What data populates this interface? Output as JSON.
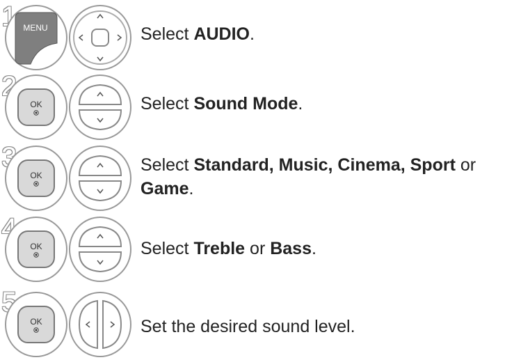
{
  "steps": [
    {
      "number": "1",
      "icons": [
        "menu-button-icon",
        "navigation-pad-icon"
      ],
      "text": {
        "pre": "Select ",
        "bold": "AUDIO",
        "post": "."
      },
      "menu_label": "MENU"
    },
    {
      "number": "2",
      "icons": [
        "ok-button-icon",
        "up-down-buttons-icon"
      ],
      "text": {
        "pre": "Select ",
        "bold": "Sound Mode",
        "post": "."
      },
      "ok_label": "OK"
    },
    {
      "number": "3",
      "icons": [
        "ok-button-icon",
        "up-down-buttons-icon"
      ],
      "text": {
        "pre": "Select ",
        "bold": "Standard, Music, Cinema, Sport",
        "mid": " or",
        "bold2": "Game",
        "post": "."
      },
      "ok_label": "OK"
    },
    {
      "number": "4",
      "icons": [
        "ok-button-icon",
        "up-down-buttons-icon"
      ],
      "text": {
        "pre": "Select ",
        "bold": "Treble",
        "mid": " or ",
        "bold2": "Bass",
        "post": "."
      },
      "ok_label": "OK"
    },
    {
      "number": "5",
      "icons": [
        "ok-button-icon",
        "left-right-buttons-icon"
      ],
      "text": {
        "pre": "Set the desired sound level."
      },
      "ok_label": "OK"
    }
  ]
}
